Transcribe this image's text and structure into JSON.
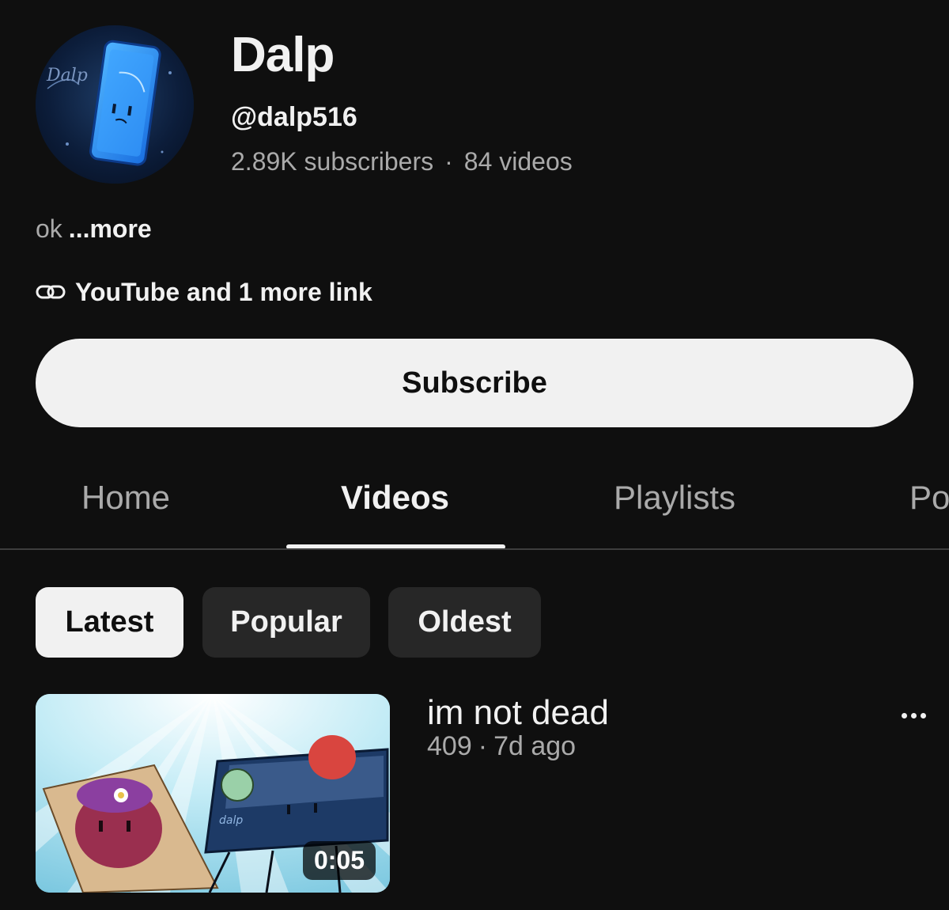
{
  "channel": {
    "name": "Dalp",
    "handle": "@dalp516",
    "subscribers": "2.89K subscribers",
    "separator": "·",
    "videos_count": "84 videos",
    "avatar_text": "Dalp",
    "description": "ok",
    "description_more": "...more",
    "links_label": "YouTube and 1 more link",
    "subscribe_label": "Subscribe"
  },
  "tabs": [
    {
      "label": "Home",
      "active": false
    },
    {
      "label": "Videos",
      "active": true
    },
    {
      "label": "Playlists",
      "active": false
    },
    {
      "label": "Po",
      "active": false
    }
  ],
  "filters": [
    {
      "label": "Latest",
      "selected": true
    },
    {
      "label": "Popular",
      "selected": false
    },
    {
      "label": "Oldest",
      "selected": false
    }
  ],
  "videos": [
    {
      "title": "im not dead",
      "views": "409",
      "separator": "·",
      "age": "7d ago",
      "duration": "0:05",
      "thumbnail_text": "dalp"
    }
  ],
  "colors": {
    "background": "#0f0f0f",
    "text_primary": "#f1f1f1",
    "text_secondary": "#aaaaaa",
    "chip_bg": "#272727",
    "button_bg": "#f1f1f1"
  },
  "icons": [
    "link-icon",
    "more-vert-icon"
  ]
}
